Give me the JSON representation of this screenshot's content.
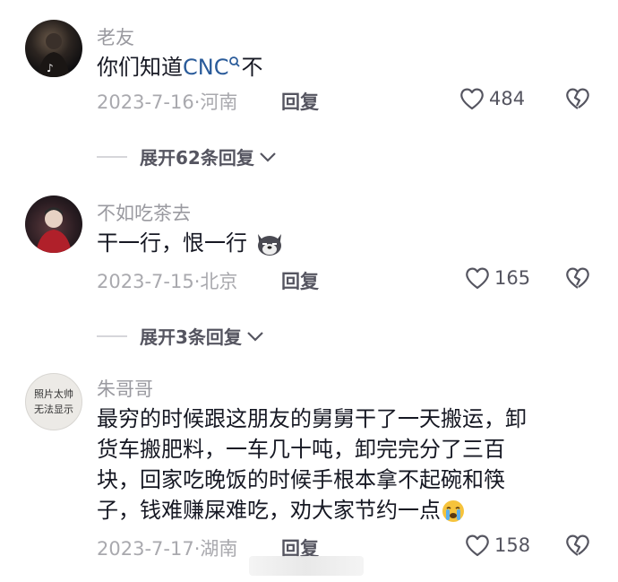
{
  "comments": [
    {
      "name": "老友",
      "text_prefix": "你们知道",
      "link": "CNC",
      "text_suffix": "不",
      "date": "2023-7-16",
      "location": "河南",
      "reply_label": "回复",
      "likes": "484",
      "expand_label": "展开62条回复"
    },
    {
      "name": "不如吃茶去",
      "text": "干一行，恨一行",
      "date": "2023-7-15",
      "location": "北京",
      "reply_label": "回复",
      "likes": "165",
      "expand_label": "展开3条回复"
    },
    {
      "name": "朱哥哥",
      "avatar_text_1": "照片太帅",
      "avatar_text_2": "无法显示",
      "text_lines": [
        "最穷的时候跟这朋友的舅舅干了一天搬运，卸",
        "货车搬肥料，一车几十吨，卸完完分了三百",
        "块，回家吃晚饭的时候手根本拿不起碗和筷",
        "子，钱难赚屎难吃，劝大家节约一点"
      ],
      "date": "2023-7-17",
      "location": "湖南",
      "reply_label": "回复",
      "likes": "158"
    }
  ],
  "separator": "·",
  "colors": {
    "link": "#2a5b9a",
    "meta": "#a9a9ae",
    "text": "#161823"
  }
}
